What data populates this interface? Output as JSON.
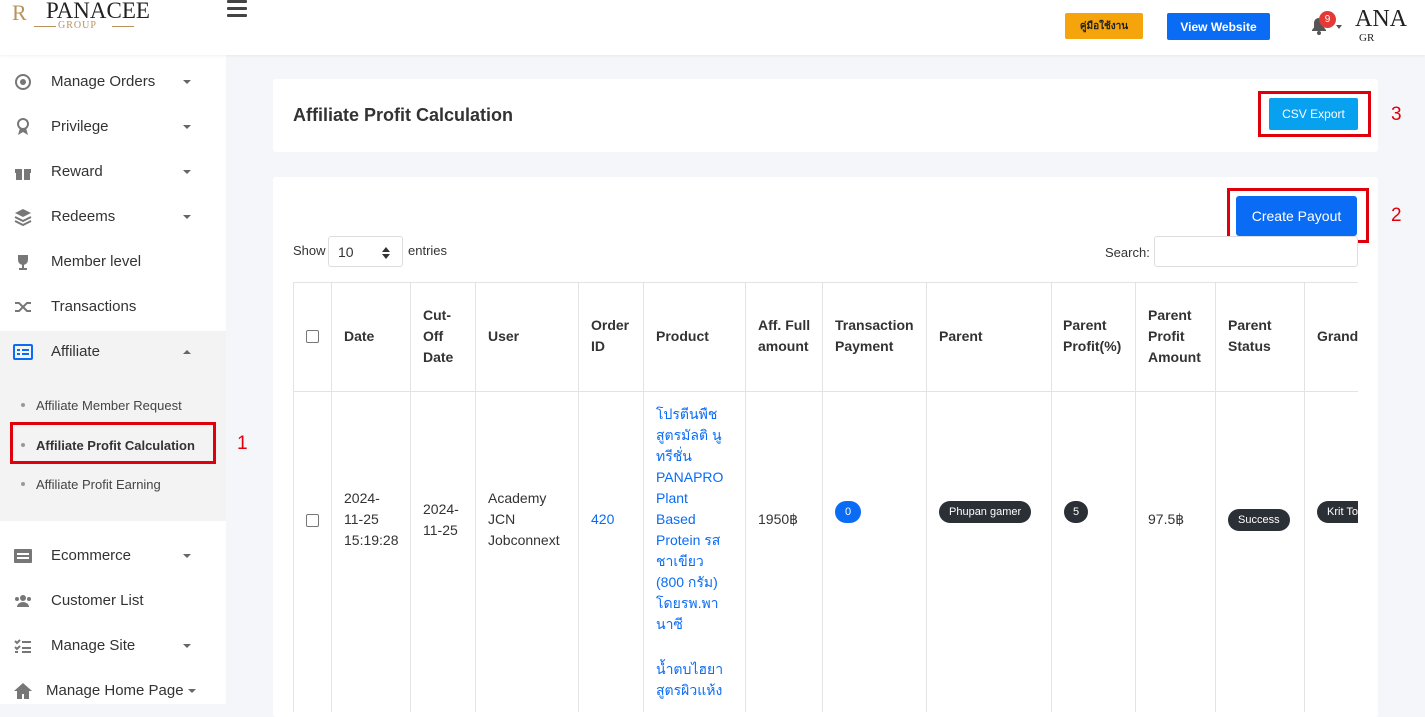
{
  "header": {
    "logo_text": "PANACEE",
    "logo_sub": "GROUP",
    "manual_button": "คู่มือใช้งาน",
    "view_website_button": "View Website",
    "notification_count": "9",
    "right_logo_text": "ANA",
    "right_logo_sub": "GR"
  },
  "sidebar": {
    "items": [
      {
        "label": "Manage Orders"
      },
      {
        "label": "Privilege"
      },
      {
        "label": "Reward"
      },
      {
        "label": "Redeems"
      },
      {
        "label": "Member level"
      },
      {
        "label": "Transactions"
      },
      {
        "label": "Affiliate"
      },
      {
        "label": "Ecommerce"
      },
      {
        "label": "Customer List"
      },
      {
        "label": "Manage Site"
      },
      {
        "label": "Manage Home Page"
      }
    ],
    "affiliate_sub": [
      {
        "label": "Affiliate Member Request"
      },
      {
        "label": "Affiliate Profit Calculation"
      },
      {
        "label": "Affiliate Profit Earning"
      }
    ]
  },
  "annotations": {
    "one": "1",
    "two": "2",
    "three": "3"
  },
  "page": {
    "title": "Affiliate Profit Calculation",
    "csv_export": "CSV Export",
    "create_payout": "Create Payout",
    "show_label": "Show",
    "entries_value": "10",
    "entries_label": "entries",
    "search_label": "Search:"
  },
  "table": {
    "headers": {
      "date": "Date",
      "cutoff_1": "Cut-",
      "cutoff_2": "Off",
      "cutoff_3": "Date",
      "user": "User",
      "order_1": "Order",
      "order_2": "ID",
      "product": "Product",
      "aff_1": "Aff. Full",
      "aff_2": "amount",
      "trans_1": "Transaction",
      "trans_2": "Payment",
      "parent": "Parent",
      "pprofit_1": "Parent",
      "pprofit_2": "Profit(%)",
      "pamount_1": "Parent",
      "pamount_2": "Profit",
      "pamount_3": "Amount",
      "pstatus_1": "Parent",
      "pstatus_2": "Status",
      "grand": "Grand"
    },
    "row": {
      "date_1": "2024-",
      "date_2": "11-25",
      "date_3": "15:19:28",
      "cutoff_1": "2024-",
      "cutoff_2": "11-25",
      "user_1": "Academy",
      "user_2": "JCN",
      "user_3": "Jobconnext",
      "order_id": "420",
      "product_lines": [
        "โปรตีนพืช",
        "สูตรมัลติ นู",
        "ทรีชั่น",
        "PANAPRO",
        "Plant",
        "Based",
        "Protein รส",
        "ชาเขียว",
        "(800 กรัม)",
        "โดยรพ.พา",
        "นาซี"
      ],
      "product2_lines": [
        "น้ำตบไฮยา",
        "สูตรผิวแห้ง"
      ],
      "aff_amount": "1950฿",
      "transaction_payment": "0",
      "parent": "Phupan gamer",
      "parent_profit_pct": "5",
      "parent_profit_amount": "97.5฿",
      "parent_status": "Success",
      "grand": "Krit To"
    }
  }
}
